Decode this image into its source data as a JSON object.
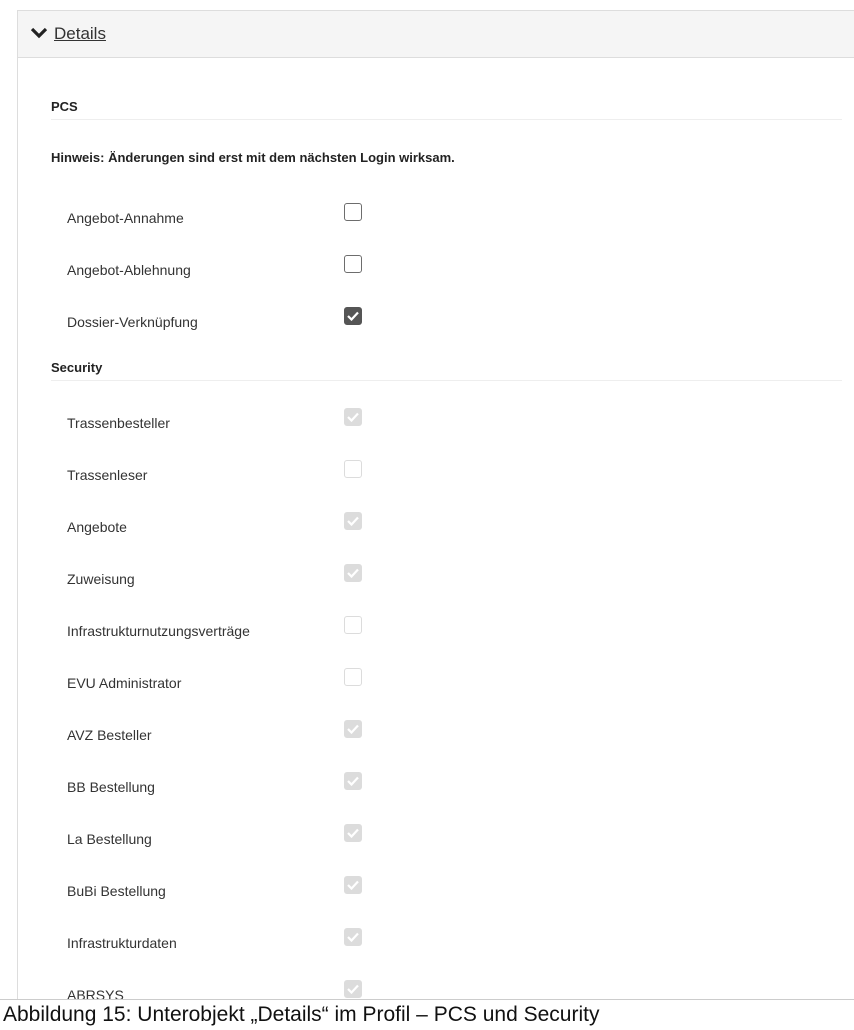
{
  "panel": {
    "title": "Details"
  },
  "pcs": {
    "heading": "PCS",
    "hint": "Hinweis: Änderungen sind erst mit dem nächsten Login wirksam.",
    "items": [
      {
        "label": "Angebot-Annahme",
        "checked": false
      },
      {
        "label": "Angebot-Ablehnung",
        "checked": false
      },
      {
        "label": "Dossier-Verknüpfung",
        "checked": true
      }
    ]
  },
  "security": {
    "heading": "Security",
    "items": [
      {
        "label": "Trassenbesteller",
        "checked": true
      },
      {
        "label": "Trassenleser",
        "checked": false
      },
      {
        "label": "Angebote",
        "checked": true
      },
      {
        "label": "Zuweisung",
        "checked": true
      },
      {
        "label": "Infrastrukturnutzungsverträge",
        "checked": false
      },
      {
        "label": "EVU Administrator",
        "checked": false
      },
      {
        "label": "AVZ Besteller",
        "checked": true
      },
      {
        "label": "BB Bestellung",
        "checked": true
      },
      {
        "label": "La Bestellung",
        "checked": true
      },
      {
        "label": "BuBi Bestellung",
        "checked": true
      },
      {
        "label": "Infrastrukturdaten",
        "checked": true
      },
      {
        "label": "ABRSYS",
        "checked": true
      }
    ]
  },
  "caption": "Abbildung 15: Unterobjekt „Details“ im Profil – PCS und Security"
}
